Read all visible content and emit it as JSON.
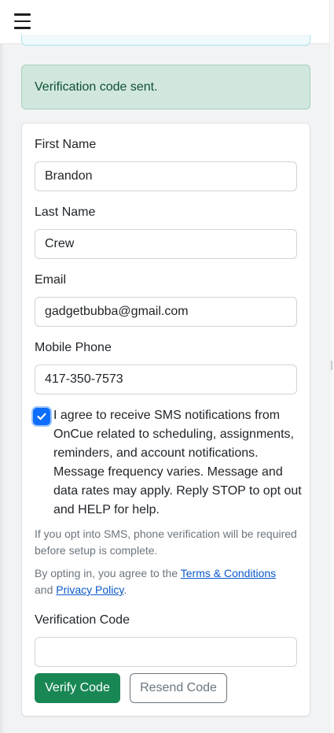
{
  "navbar": {
    "menu_icon": "hamburger-icon"
  },
  "alert": {
    "message": "Verification code sent."
  },
  "form": {
    "first_name": {
      "label": "First Name",
      "value": "Brandon"
    },
    "last_name": {
      "label": "Last Name",
      "value": "Crew"
    },
    "email": {
      "label": "Email",
      "value": "gadgetbubba@gmail.com"
    },
    "mobile_phone": {
      "label": "Mobile Phone",
      "value": "417-350-7573"
    },
    "sms_consent": {
      "checked": true,
      "text": "I agree to receive SMS notifications from OnCue related to scheduling, assignments, reminders, and account notifications. Message frequency varies. Message and data rates may apply. Reply STOP to opt out and HELP for help."
    },
    "sms_note": "If you opt into SMS, phone verification will be required before setup is complete.",
    "terms": {
      "prefix": "By opting in, you agree to the ",
      "terms_link": "Terms & Conditions",
      "middle": "and ",
      "privacy_link": "Privacy Policy",
      "suffix": "."
    },
    "verification_code": {
      "label": "Verification Code",
      "value": ""
    },
    "verify_button": "Verify Code",
    "resend_button": "Resend Code"
  },
  "colors": {
    "success_bg": "#d1e7dd",
    "success_text": "#0f5132",
    "primary_green": "#198754",
    "checkbox_blue": "#0d6efd",
    "link_blue": "#0a58ca"
  }
}
